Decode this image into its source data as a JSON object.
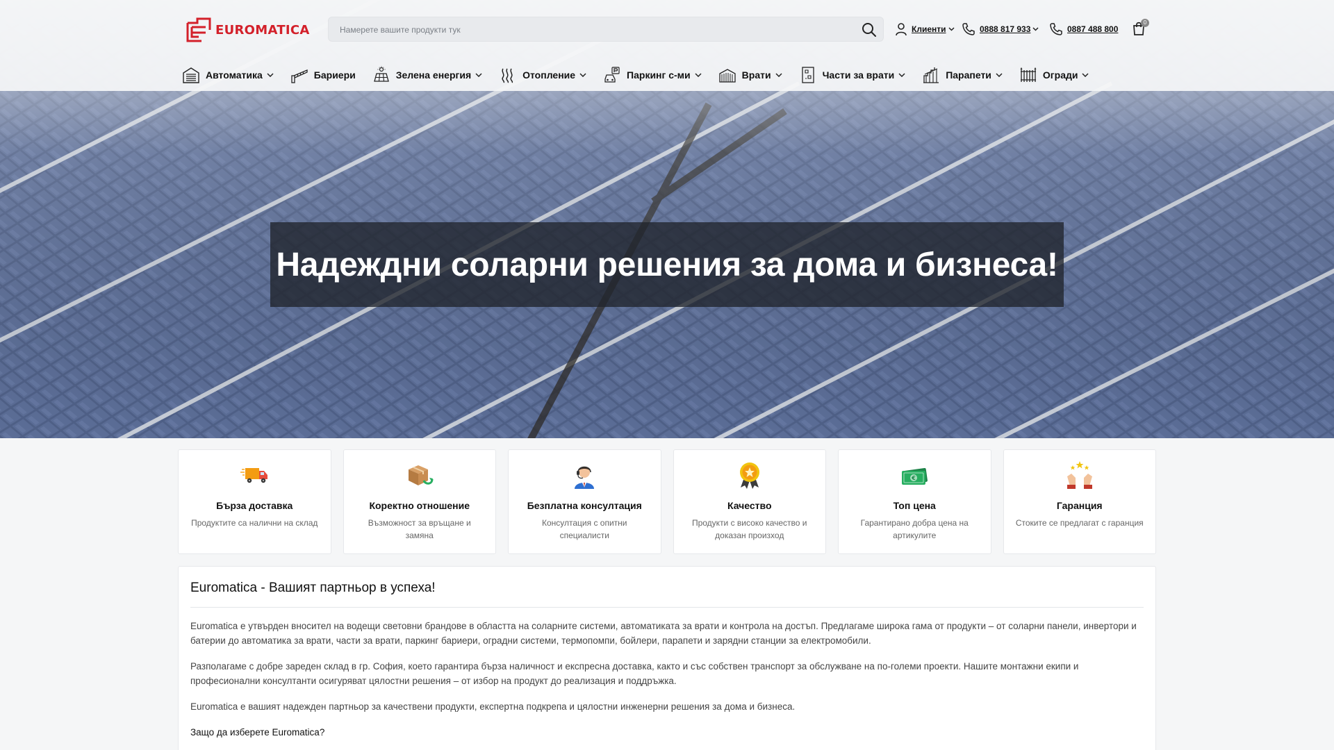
{
  "header": {
    "logo_text": "EUROMATICA",
    "search_placeholder": "Намерете вашите продукти тук",
    "account_label": "Клиенти",
    "phone_1": "0888 817 933",
    "phone_2": "0887 488 800",
    "cart_count": "0"
  },
  "nav": {
    "items": [
      {
        "label": "Автоматика",
        "icon": "garage-door-icon",
        "dropdown": true
      },
      {
        "label": "Бариери",
        "icon": "barrier-icon",
        "dropdown": false
      },
      {
        "label": "Зелена енергия",
        "icon": "solar-panel-icon",
        "dropdown": true
      },
      {
        "label": "Отопление",
        "icon": "heating-icon",
        "dropdown": true
      },
      {
        "label": "Паркинг с-ми",
        "icon": "parking-car-icon",
        "dropdown": true
      },
      {
        "label": "Врати",
        "icon": "roller-door-icon",
        "dropdown": true
      },
      {
        "label": "Части за врати",
        "icon": "door-parts-icon",
        "dropdown": true
      },
      {
        "label": "Парапети",
        "icon": "railing-icon",
        "dropdown": true
      },
      {
        "label": "Огради",
        "icon": "fence-icon",
        "dropdown": true
      }
    ]
  },
  "hero": {
    "title": "Надеждни соларни решения за дома и бизнеса!"
  },
  "features": [
    {
      "title": "Бърза доставка",
      "desc": "Продуктите са налични на склад",
      "icon": "delivery-truck-icon"
    },
    {
      "title": "Коректно отношение",
      "desc": "Възможност за връщане и замяна",
      "icon": "return-box-icon"
    },
    {
      "title": "Безплатна консултация",
      "desc": "Консултация с опитни специалисти",
      "icon": "consultant-icon"
    },
    {
      "title": "Качество",
      "desc": "Продукти с високо качество и доказан произход",
      "icon": "quality-medal-icon"
    },
    {
      "title": "Топ цена",
      "desc": "Гарантирано добра цена на артикулите",
      "icon": "money-icon"
    },
    {
      "title": "Гаранция",
      "desc": "Стоките се предлагат с гаранция",
      "icon": "guarantee-stars-icon"
    }
  ],
  "about": {
    "title": "Euromatica - Вашият партньор в успеха!",
    "p1": "Euromatica е утвърден вносител на водещи световни брандове в областта на соларните системи, автоматиката за врати и контрола на достъп. Предлагаме широка гама от продукти – от соларни панели, инвертори и батерии до автоматика за врати, части за врати, паркинг бариери, оградни системи, термопомпи, бойлери, парапети и зарядни станции за електромобили.",
    "p2": "Разполагаме с добре зареден склад в гр. София, което гарантира бърза наличност и експресна доставка, както и със собствен транспорт за обслужване на по-големи проекти. Нашите монтажни екипи и професионални консултанти осигуряват цялостни решения – от избор на продукт до реализация и поддръжка.",
    "p3": "Euromatica е вашият надежден партньор за качествени продукти, експертна подкрепа и цялостни инженерни решения за дома и бизнеса.",
    "q": "Защо да изберете Euromatica?"
  },
  "colors": {
    "brand_red": "#d3202a",
    "text_dark": "#111111",
    "hero_overlay": "#20242c"
  }
}
